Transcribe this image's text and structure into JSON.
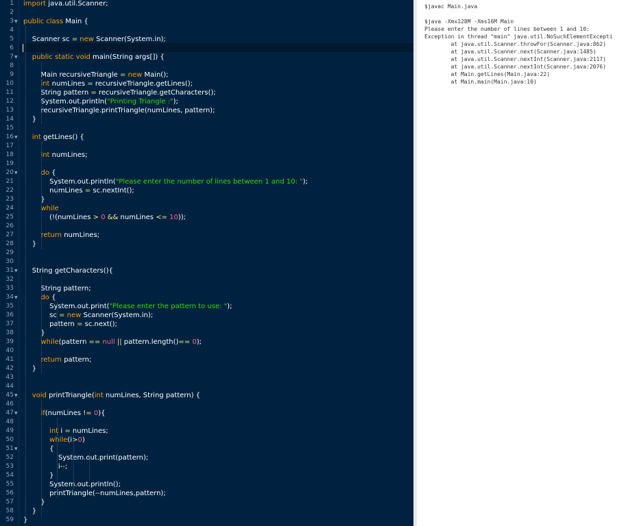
{
  "editor": {
    "lines": [
      [
        [
          "k",
          "import"
        ],
        [
          "t",
          " java.util.Scanner;"
        ]
      ],
      [],
      [
        [
          "k",
          "public"
        ],
        [
          "t",
          " "
        ],
        [
          "k",
          "class"
        ],
        [
          "t",
          " Main {"
        ]
      ],
      [],
      [
        [
          "t",
          "    Scanner sc "
        ],
        [
          "p",
          "="
        ],
        [
          "t",
          " "
        ],
        [
          "k",
          "new"
        ],
        [
          "t",
          " Scanner(System.in);"
        ]
      ],
      [],
      [
        [
          "t",
          "    "
        ],
        [
          "k",
          "public"
        ],
        [
          "t",
          " "
        ],
        [
          "k",
          "static"
        ],
        [
          "t",
          " "
        ],
        [
          "k",
          "void"
        ],
        [
          "t",
          " main(String args[]) {"
        ]
      ],
      [],
      [
        [
          "t",
          "        Main recursiveTriangle "
        ],
        [
          "p",
          "="
        ],
        [
          "t",
          " "
        ],
        [
          "k",
          "new"
        ],
        [
          "t",
          " Main();"
        ]
      ],
      [
        [
          "t",
          "        "
        ],
        [
          "k",
          "int"
        ],
        [
          "t",
          " numLines "
        ],
        [
          "p",
          "="
        ],
        [
          "t",
          " recursiveTriangle.getLines();"
        ]
      ],
      [
        [
          "t",
          "        String pattern "
        ],
        [
          "p",
          "="
        ],
        [
          "t",
          " recursiveTriangle.getCharacters();"
        ]
      ],
      [
        [
          "t",
          "        System.out.println("
        ],
        [
          "s",
          "\"Printing Triangle :\""
        ],
        [
          "t",
          ");"
        ]
      ],
      [
        [
          "t",
          "        recursiveTriangle.printTriangle(numLines, pattern);"
        ]
      ],
      [
        [
          "t",
          "    }"
        ]
      ],
      [],
      [
        [
          "t",
          "    "
        ],
        [
          "k",
          "int"
        ],
        [
          "t",
          " getLines() {"
        ]
      ],
      [],
      [
        [
          "t",
          "        "
        ],
        [
          "k",
          "int"
        ],
        [
          "t",
          " numLines;"
        ]
      ],
      [],
      [
        [
          "t",
          "        "
        ],
        [
          "k",
          "do"
        ],
        [
          "t",
          " {"
        ]
      ],
      [
        [
          "t",
          "            System.out.println("
        ],
        [
          "s",
          "\"Please enter the number of lines between 1 and 10: \""
        ],
        [
          "t",
          ");"
        ]
      ],
      [
        [
          "t",
          "            numLines "
        ],
        [
          "p",
          "="
        ],
        [
          "t",
          " sc.nextInt();"
        ]
      ],
      [
        [
          "t",
          "        }"
        ]
      ],
      [
        [
          "t",
          "        "
        ],
        [
          "k",
          "while"
        ]
      ],
      [
        [
          "t",
          "            (!(numLines "
        ],
        [
          "p",
          ">"
        ],
        [
          "t",
          " "
        ],
        [
          "n",
          "0"
        ],
        [
          "t",
          " "
        ],
        [
          "p",
          "&&"
        ],
        [
          "t",
          " numLines "
        ],
        [
          "p",
          "<="
        ],
        [
          "t",
          " "
        ],
        [
          "n",
          "10"
        ],
        [
          "t",
          "));"
        ]
      ],
      [],
      [
        [
          "t",
          "        "
        ],
        [
          "k",
          "return"
        ],
        [
          "t",
          " numLines;"
        ]
      ],
      [
        [
          "t",
          "    }"
        ]
      ],
      [],
      [],
      [
        [
          "t",
          "    String getCharacters(){"
        ]
      ],
      [],
      [
        [
          "t",
          "        String pattern;"
        ]
      ],
      [
        [
          "t",
          "        "
        ],
        [
          "k",
          "do"
        ],
        [
          "t",
          " {"
        ]
      ],
      [
        [
          "t",
          "            System.out.print("
        ],
        [
          "s",
          "\"Please enter the pattern to use: \""
        ],
        [
          "t",
          ");"
        ]
      ],
      [
        [
          "t",
          "            sc "
        ],
        [
          "p",
          "="
        ],
        [
          "t",
          " "
        ],
        [
          "k",
          "new"
        ],
        [
          "t",
          " Scanner(System.in);"
        ]
      ],
      [
        [
          "t",
          "            pattern "
        ],
        [
          "p",
          "="
        ],
        [
          "t",
          " sc.next();"
        ]
      ],
      [
        [
          "t",
          "        }"
        ]
      ],
      [
        [
          "t",
          "        "
        ],
        [
          "k",
          "while"
        ],
        [
          "t",
          "(pattern "
        ],
        [
          "p",
          "=="
        ],
        [
          "t",
          " "
        ],
        [
          "n",
          "null"
        ],
        [
          "t",
          " "
        ],
        [
          "p",
          "||"
        ],
        [
          "t",
          " pattern.length()"
        ],
        [
          "p",
          "=="
        ],
        [
          "t",
          " "
        ],
        [
          "n",
          "0"
        ],
        [
          "t",
          ");"
        ]
      ],
      [],
      [
        [
          "t",
          "        "
        ],
        [
          "k",
          "return"
        ],
        [
          "t",
          " pattern;"
        ]
      ],
      [
        [
          "t",
          "    }"
        ]
      ],
      [],
      [],
      [
        [
          "t",
          "    "
        ],
        [
          "k",
          "void"
        ],
        [
          "t",
          " printTriangle("
        ],
        [
          "k",
          "int"
        ],
        [
          "t",
          " numLines, String pattern) {"
        ]
      ],
      [],
      [
        [
          "t",
          "        "
        ],
        [
          "k",
          "if"
        ],
        [
          "t",
          "(numLines "
        ],
        [
          "p",
          "!="
        ],
        [
          "t",
          " "
        ],
        [
          "n",
          "0"
        ],
        [
          "t",
          "){"
        ]
      ],
      [],
      [
        [
          "t",
          "            "
        ],
        [
          "k",
          "int"
        ],
        [
          "t",
          " i "
        ],
        [
          "p",
          "="
        ],
        [
          "t",
          " numLines;"
        ]
      ],
      [
        [
          "t",
          "            "
        ],
        [
          "k",
          "while"
        ],
        [
          "t",
          "(i"
        ],
        [
          "p",
          ">"
        ],
        [
          "n",
          "0"
        ],
        [
          "t",
          ")"
        ]
      ],
      [
        [
          "t",
          "            {"
        ]
      ],
      [
        [
          "t",
          "                System.out.print(pattern);"
        ]
      ],
      [
        [
          "t",
          "                i"
        ],
        [
          "p",
          "--"
        ],
        [
          "t",
          ";"
        ]
      ],
      [
        [
          "t",
          "            }"
        ]
      ],
      [
        [
          "t",
          "            System.out.println();"
        ]
      ],
      [
        [
          "t",
          "            printTriangle("
        ],
        [
          "p",
          "--"
        ],
        [
          "t",
          "numLines,pattern);"
        ]
      ],
      [
        [
          "t",
          "        }"
        ]
      ],
      [
        [
          "t",
          "    }"
        ]
      ],
      [
        [
          "t",
          "}"
        ]
      ]
    ],
    "fold_markers": [
      3,
      7,
      16,
      20,
      31,
      34,
      45,
      47,
      51
    ],
    "fold_glyph": "▼"
  },
  "console": {
    "lines": [
      "$javac Main.java",
      "",
      "$java -Xmx128M -Xms16M Main",
      "Please enter the number of lines between 1 and 10:",
      "Exception in thread \"main\" java.util.NoSuchElementExcepti",
      "        at java.util.Scanner.throwFor(Scanner.java:862)",
      "        at java.util.Scanner.next(Scanner.java:1485)",
      "        at java.util.Scanner.nextInt(Scanner.java:2117)",
      "        at java.util.Scanner.nextInt(Scanner.java:2076)",
      "        at Main.getLines(Main.java:22)",
      "        at Main.main(Main.java:10)"
    ]
  },
  "colors": {
    "editor_background": "#002240",
    "keyword": "#ff9d00",
    "string": "#3ad900",
    "number": "#ff628c",
    "operator": "#ffee80",
    "console_background": "#ffffff"
  }
}
